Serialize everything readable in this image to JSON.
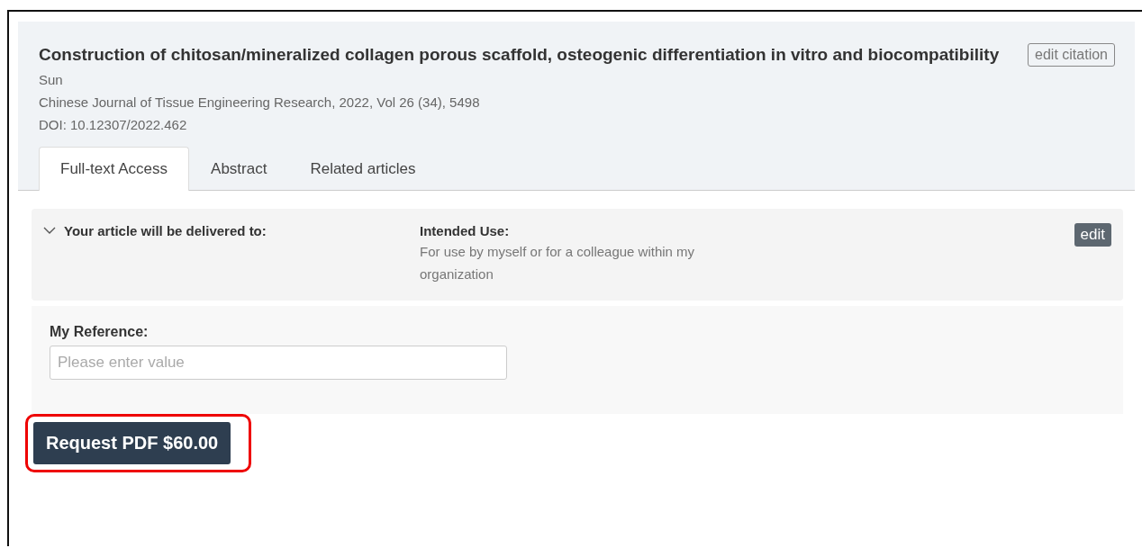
{
  "article": {
    "title": "Construction of chitosan/mineralized collagen porous scaffold, osteogenic differentiation in vitro and biocompatibility",
    "author": "Sun",
    "source": "Chinese Journal of Tissue Engineering Research, 2022, Vol 26 (34), 5498",
    "doi": "DOI: 10.12307/2022.462",
    "edit_button": "edit citation"
  },
  "tabs": [
    {
      "label": "Full-text Access",
      "selected": true
    },
    {
      "label": "Abstract",
      "selected": false
    },
    {
      "label": "Related articles",
      "selected": false
    }
  ],
  "delivery": {
    "expanded": true,
    "heading": "Your article will be delivered to:",
    "use_label": "Intended Use:",
    "use_text": "For use by myself or for a colleague within my organization",
    "edit_button": "edit"
  },
  "reference": {
    "label": "My Reference:",
    "placeholder": "Please enter value"
  },
  "request_button": {
    "label": "Request PDF $60.00",
    "highlighted": true
  }
}
